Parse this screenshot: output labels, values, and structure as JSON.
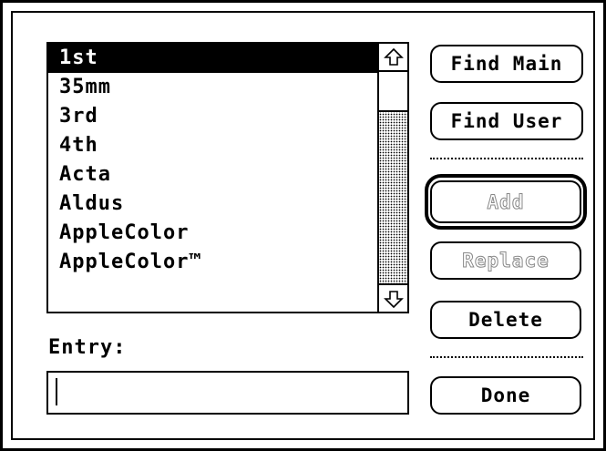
{
  "dialog": {
    "list": {
      "items": [
        "1st",
        "35mm",
        "3rd",
        "4th",
        "Acta",
        "Aldus",
        "AppleColor",
        "AppleColor™"
      ],
      "selected_index": 0
    },
    "scrollbar": {
      "up_icon": "up-arrow-icon",
      "down_icon": "down-arrow-icon"
    },
    "entry": {
      "label": "Entry:",
      "value": ""
    },
    "buttons": {
      "find_main": "Find Main",
      "find_user": "Find User",
      "add": "Add",
      "replace": "Replace",
      "delete": "Delete",
      "done": "Done"
    }
  }
}
